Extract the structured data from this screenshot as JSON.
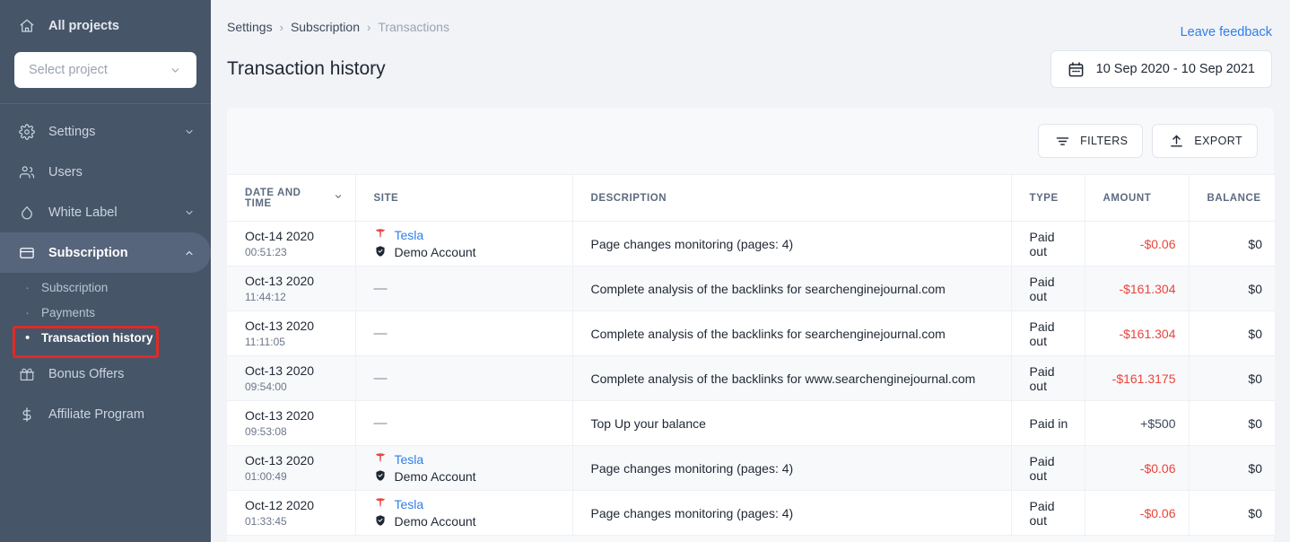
{
  "sidebar": {
    "all_projects": {
      "label": "All projects",
      "icon": "home-icon"
    },
    "project_select": {
      "placeholder": "Select project",
      "icon": "chevron-down-icon"
    },
    "nav": [
      {
        "label": "Settings",
        "icon": "gear-icon",
        "expandable": true,
        "expanded": false
      },
      {
        "label": "Users",
        "icon": "users-icon",
        "expandable": false
      },
      {
        "label": "White Label",
        "icon": "droplet-icon",
        "expandable": true,
        "expanded": false
      },
      {
        "label": "Subscription",
        "icon": "credit-card-icon",
        "expandable": true,
        "expanded": true,
        "active": true
      },
      {
        "label": "Bonus Offers",
        "icon": "gift-icon",
        "expandable": false
      },
      {
        "label": "Affiliate Program",
        "icon": "dollar-icon",
        "expandable": false
      }
    ],
    "subnav": [
      {
        "label": "Subscription",
        "active": false
      },
      {
        "label": "Payments",
        "active": false
      },
      {
        "label": "Transaction history",
        "active": true,
        "highlighted": true
      }
    ],
    "highlight_color": "#e02a26"
  },
  "header": {
    "breadcrumb": [
      {
        "label": "Settings",
        "current": false
      },
      {
        "label": "Subscription",
        "current": false
      },
      {
        "label": "Transactions",
        "current": true
      }
    ],
    "separator": "›",
    "feedback_link": "Leave feedback",
    "page_title": "Transaction history",
    "date_range": "10 Sep 2020 - 10 Sep 2021",
    "date_icon": "calendar-icon",
    "link_color": "#2f7fe8"
  },
  "toolbar": {
    "filters_label": "FILTERS",
    "filters_icon": "filter-icon",
    "export_label": "EXPORT",
    "export_icon": "upload-icon"
  },
  "table": {
    "columns": [
      {
        "key": "date",
        "label": "DATE AND TIME",
        "sortable": true,
        "sort_icon": "chevron-down-icon"
      },
      {
        "key": "site",
        "label": "SITE",
        "sortable": false
      },
      {
        "key": "description",
        "label": "DESCRIPTION",
        "sortable": false
      },
      {
        "key": "type",
        "label": "TYPE",
        "sortable": false
      },
      {
        "key": "amount",
        "label": "AMOUNT",
        "sortable": false
      },
      {
        "key": "balance",
        "label": "BALANCE",
        "sortable": false
      }
    ],
    "rows": [
      {
        "date": "Oct-14 2020",
        "time": "00:51:23",
        "site": "Tesla",
        "site_icon": "tesla-logo-icon",
        "account": "Demo Account",
        "account_icon": "shield-check-icon",
        "description": "Page changes monitoring (pages: 4)",
        "type": "Paid out",
        "amount": "-$0.06",
        "amount_sign": "negative",
        "balance": "$0"
      },
      {
        "date": "Oct-13 2020",
        "time": "11:44:12",
        "site": "—",
        "site_icon": null,
        "account": null,
        "account_icon": null,
        "description": "Complete analysis of the backlinks for searchenginejournal.com",
        "type": "Paid out",
        "amount": "-$161.304",
        "amount_sign": "negative",
        "balance": "$0"
      },
      {
        "date": "Oct-13 2020",
        "time": "11:11:05",
        "site": "—",
        "site_icon": null,
        "account": null,
        "account_icon": null,
        "description": "Complete analysis of the backlinks for searchenginejournal.com",
        "type": "Paid out",
        "amount": "-$161.304",
        "amount_sign": "negative",
        "balance": "$0"
      },
      {
        "date": "Oct-13 2020",
        "time": "09:54:00",
        "site": "—",
        "site_icon": null,
        "account": null,
        "account_icon": null,
        "description": "Complete analysis of the backlinks for www.searchenginejournal.com",
        "type": "Paid out",
        "amount": "-$161.3175",
        "amount_sign": "negative",
        "balance": "$0"
      },
      {
        "date": "Oct-13 2020",
        "time": "09:53:08",
        "site": "—",
        "site_icon": null,
        "account": null,
        "account_icon": null,
        "description": "Top Up your balance",
        "type": "Paid in",
        "amount": "+$500",
        "amount_sign": "positive",
        "balance": "$0"
      },
      {
        "date": "Oct-13 2020",
        "time": "01:00:49",
        "site": "Tesla",
        "site_icon": "tesla-logo-icon",
        "account": "Demo Account",
        "account_icon": "shield-check-icon",
        "description": "Page changes monitoring (pages: 4)",
        "type": "Paid out",
        "amount": "-$0.06",
        "amount_sign": "negative",
        "balance": "$0"
      },
      {
        "date": "Oct-12 2020",
        "time": "01:33:45",
        "site": "Tesla",
        "site_icon": "tesla-logo-icon",
        "account": "Demo Account",
        "account_icon": "shield-check-icon",
        "description": "Page changes monitoring (pages: 4)",
        "type": "Paid out",
        "amount": "-$0.06",
        "amount_sign": "negative",
        "balance": "$0"
      }
    ],
    "negative_color": "#e8453c",
    "site_link_color": "#2f7fe8"
  }
}
